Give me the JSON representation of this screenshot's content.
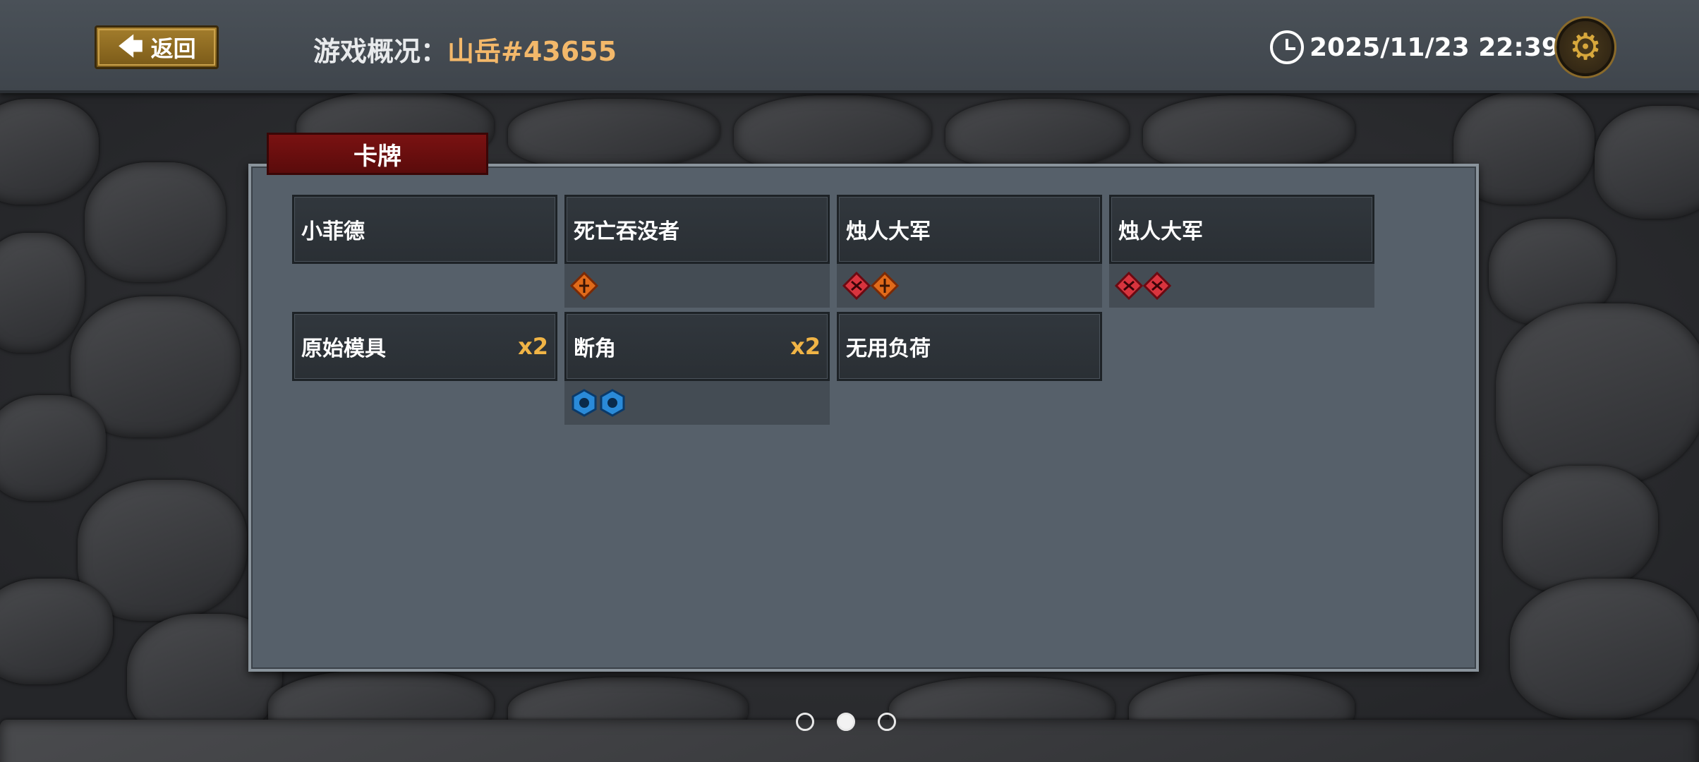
{
  "header": {
    "back_label": "返回",
    "title_prefix": "游戏概况：",
    "game_id": "山岳#43655",
    "datetime": "2025/11/23 22:39"
  },
  "panel": {
    "tab_label": "卡牌"
  },
  "cards": [
    {
      "name": "小菲德",
      "count": "",
      "icons": []
    },
    {
      "name": "死亡吞没者",
      "count": "",
      "icons": [
        "orange-diamond-icon"
      ]
    },
    {
      "name": "烛人大军",
      "count": "",
      "icons": [
        "red-diamond-icon",
        "orange-diamond-icon"
      ]
    },
    {
      "name": "烛人大军",
      "count": "",
      "icons": [
        "red-diamond-icon",
        "red-diamond-icon"
      ]
    },
    {
      "name": "原始模具",
      "count": "x2",
      "icons": []
    },
    {
      "name": "断角",
      "count": "x2",
      "icons": [
        "blue-hexagon-icon",
        "blue-hexagon-icon"
      ]
    },
    {
      "name": "无用负荷",
      "count": "",
      "icons": []
    }
  ],
  "pagination": {
    "pages": 3,
    "current": 2
  },
  "colors": {
    "accent_gold": "#f0b446",
    "game_id": "#f3b86a",
    "tab_red": "#7a1212"
  }
}
